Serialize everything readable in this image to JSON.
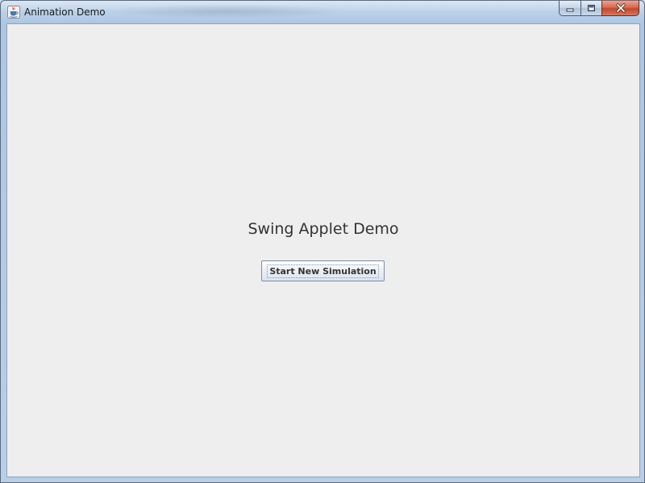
{
  "window": {
    "title": "Animation Demo",
    "icon": "java-cup-icon",
    "caption_buttons": [
      "minimize-icon",
      "maximize-icon",
      "close-icon"
    ]
  },
  "main": {
    "heading": "Swing Applet Demo",
    "start_button_label": "Start New Simulation"
  },
  "colors": {
    "client_background": "#eeeeee",
    "close_button": "#c2472c",
    "titlebar": "#bcd1e8"
  }
}
